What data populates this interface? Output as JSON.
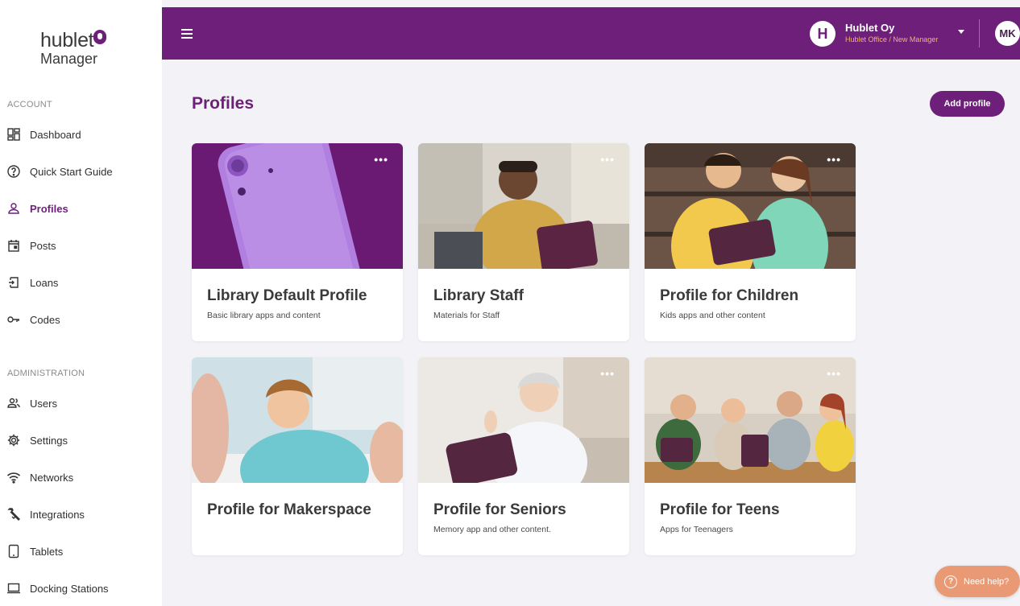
{
  "logo": {
    "line1": "hublet",
    "line2": "Manager"
  },
  "sidebar": {
    "account_label": "ACCOUNT",
    "admin_label": "ADMINISTRATION",
    "account_items": [
      {
        "label": "Dashboard",
        "icon": "dashboard-icon"
      },
      {
        "label": "Quick Start Guide",
        "icon": "question-circle-icon"
      },
      {
        "label": "Profiles",
        "icon": "person-icon",
        "active": true
      },
      {
        "label": "Posts",
        "icon": "calendar-icon"
      },
      {
        "label": "Loans",
        "icon": "loan-icon"
      },
      {
        "label": "Codes",
        "icon": "key-icon"
      }
    ],
    "admin_items": [
      {
        "label": "Users",
        "icon": "users-icon"
      },
      {
        "label": "Settings",
        "icon": "gear-icon"
      },
      {
        "label": "Networks",
        "icon": "wifi-icon"
      },
      {
        "label": "Integrations",
        "icon": "wrench-icon"
      },
      {
        "label": "Tablets",
        "icon": "tablet-icon"
      },
      {
        "label": "Docking Stations",
        "icon": "laptop-icon"
      }
    ]
  },
  "topbar": {
    "org_initial": "H",
    "org_name": "Hublet Oy",
    "org_sub": "Hublet Office / New Manager",
    "user_initials": "MK"
  },
  "main": {
    "title": "Profiles",
    "add_button": "Add profile",
    "more_label": "•••",
    "cards": [
      {
        "title": "Library Default Profile",
        "desc": "Basic library apps and content"
      },
      {
        "title": "Library Staff",
        "desc": "Materials for Staff"
      },
      {
        "title": "Profile for Children",
        "desc": "Kids apps and other content"
      },
      {
        "title": "Profile for Makerspace",
        "desc": ""
      },
      {
        "title": "Profile for Seniors",
        "desc": "Memory app and other content."
      },
      {
        "title": "Profile for Teens",
        "desc": "Apps for Teenagers"
      }
    ]
  },
  "help": {
    "label": "Need help?",
    "icon": "question-icon"
  },
  "colors": {
    "brand": "#6d1f7a",
    "accent": "#f2b46f",
    "help": "#e99a74"
  }
}
